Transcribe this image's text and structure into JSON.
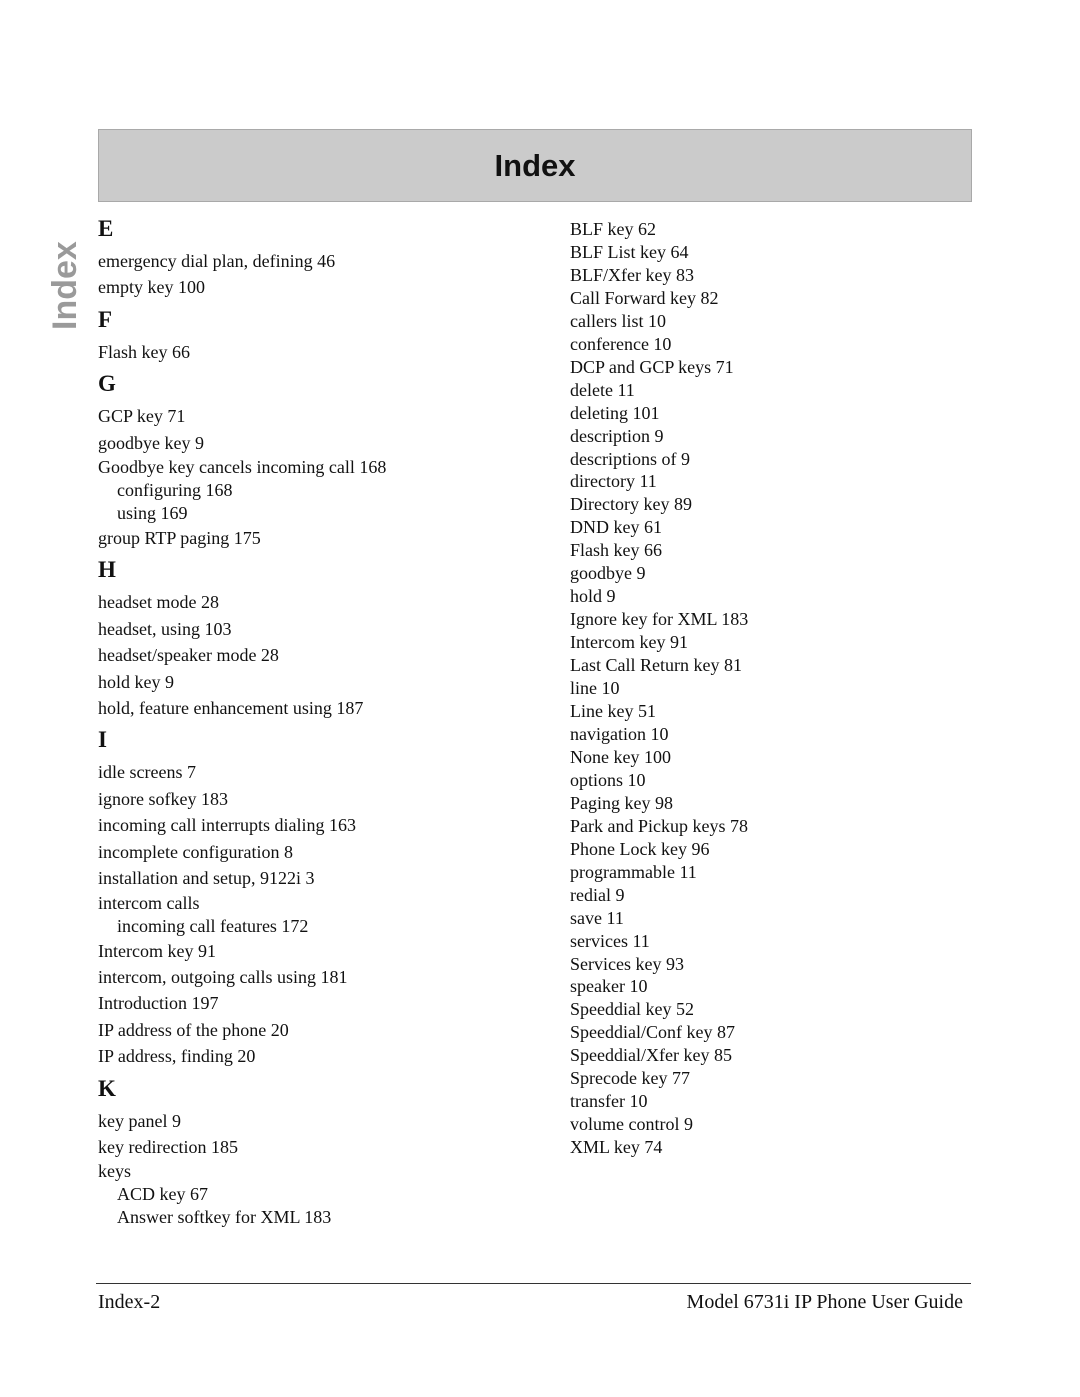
{
  "header": {
    "title": "Index"
  },
  "side_tab": {
    "label": "Index"
  },
  "left_column": [
    {
      "letter": "E",
      "entries": [
        {
          "text": "emergency dial plan, defining 46"
        },
        {
          "text": "empty key 100"
        }
      ]
    },
    {
      "letter": "F",
      "entries": [
        {
          "text": "Flash key 66"
        }
      ]
    },
    {
      "letter": "G",
      "entries": [
        {
          "text": "GCP key 71"
        },
        {
          "text": "goodbye key 9"
        },
        {
          "text": "Goodbye key cancels incoming call 168",
          "subs": [
            "configuring 168",
            "using 169"
          ]
        },
        {
          "text": "group RTP paging 175"
        }
      ]
    },
    {
      "letter": "H",
      "entries": [
        {
          "text": "headset mode 28"
        },
        {
          "text": "headset, using 103"
        },
        {
          "text": "headset/speaker mode 28"
        },
        {
          "text": "hold key 9"
        },
        {
          "text": "hold, feature enhancement using 187"
        }
      ]
    },
    {
      "letter": "I",
      "entries": [
        {
          "text": "idle screens 7"
        },
        {
          "text": "ignore sofkey 183"
        },
        {
          "text": "incoming call interrupts dialing 163"
        },
        {
          "text": "incomplete configuration 8"
        },
        {
          "text": "installation and setup, 9122i 3"
        },
        {
          "text": "intercom calls",
          "subs": [
            "incoming call features 172"
          ]
        },
        {
          "text": "Intercom key 91"
        },
        {
          "text": "intercom, outgoing calls using 181"
        },
        {
          "text": "Introduction 197"
        },
        {
          "text": "IP address of the phone 20"
        },
        {
          "text": "IP address, finding 20"
        }
      ]
    },
    {
      "letter": "K",
      "entries": [
        {
          "text": "key panel 9"
        },
        {
          "text": "key redirection 185"
        },
        {
          "text": "keys",
          "subs": [
            "ACD key 67",
            "Answer softkey for XML 183"
          ]
        }
      ]
    }
  ],
  "right_column": [
    "BLF key 62",
    "BLF List key 64",
    "BLF/Xfer key 83",
    "Call Forward key 82",
    "callers list 10",
    "conference 10",
    "DCP and GCP keys 71",
    "delete 11",
    "deleting 101",
    "description 9",
    "descriptions of 9",
    "directory 11",
    "Directory key 89",
    "DND key 61",
    "Flash key 66",
    "goodbye 9",
    "hold 9",
    "Ignore key for XML 183",
    "Intercom key 91",
    "Last Call Return key 81",
    "line 10",
    "Line key 51",
    "navigation 10",
    "None key 100",
    "options 10",
    "Paging key 98",
    "Park and Pickup keys 78",
    "Phone Lock key 96",
    "programmable 11",
    "redial 9",
    "save 11",
    "services 11",
    "Services key 93",
    "speaker 10",
    "Speeddial key 52",
    "Speeddial/Conf key 87",
    "Speeddial/Xfer key 85",
    "Sprecode key 77",
    "transfer 10",
    "volume control 9",
    "XML key 74"
  ],
  "footer": {
    "page_label": "Index-2",
    "doc_title": "Model 6731i IP Phone User Guide"
  }
}
